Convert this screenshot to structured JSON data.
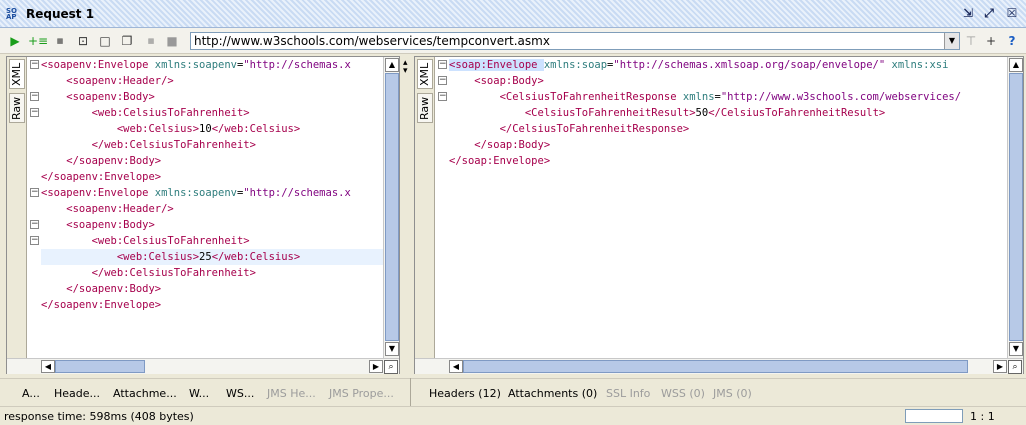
{
  "window": {
    "title": "Request 1",
    "icon": "soap-request-icon",
    "controls": [
      "detach-icon",
      "maximize-icon",
      "close-icon"
    ]
  },
  "toolbar": {
    "url": "http://www.w3schools.com/webservices/tempconvert.asmx",
    "icons": [
      "run-icon",
      "add-assertion-icon",
      "create-soap-icon",
      "restore-icon",
      "clone-icon",
      "soap-icon",
      "stop-icon"
    ],
    "right_icons": [
      "tune-icon",
      "add-icon",
      "help-icon"
    ]
  },
  "request_panel": {
    "tabs": [
      "XML",
      "Raw"
    ],
    "lines": [
      [
        {
          "c": "tag",
          "t": "<soapenv:Envelope "
        },
        {
          "c": "an",
          "t": "xmlns:soapenv"
        },
        {
          "c": "txt",
          "t": "="
        },
        {
          "c": "av",
          "t": "\"http://schemas.x"
        }
      ],
      [
        {
          "c": "tag",
          "t": "    <soapenv:Header/>"
        }
      ],
      [
        {
          "c": "tag",
          "t": "    <soapenv:Body>"
        }
      ],
      [
        {
          "c": "tag",
          "t": "        <web:CelsiusToFahrenheit>"
        }
      ],
      [
        {
          "c": "tag",
          "t": "            <web:Celsius>"
        },
        {
          "c": "txt",
          "t": "10"
        },
        {
          "c": "tag",
          "t": "</web:Celsius>"
        }
      ],
      [
        {
          "c": "tag",
          "t": "        </web:CelsiusToFahrenheit>"
        }
      ],
      [
        {
          "c": "tag",
          "t": "    </soapenv:Body>"
        }
      ],
      [
        {
          "c": "tag",
          "t": "</soapenv:Envelope>"
        }
      ],
      [
        {
          "c": "tag",
          "t": "<soapenv:Envelope "
        },
        {
          "c": "an",
          "t": "xmlns:soapenv"
        },
        {
          "c": "txt",
          "t": "="
        },
        {
          "c": "av",
          "t": "\"http://schemas.x"
        }
      ],
      [
        {
          "c": "tag",
          "t": "    <soapenv:Header/>"
        }
      ],
      [
        {
          "c": "tag",
          "t": "    <soapenv:Body>"
        }
      ],
      [
        {
          "c": "tag",
          "t": "        <web:CelsiusToFahrenheit>"
        }
      ],
      [
        {
          "c": "tag",
          "t": "            <web:Celsius>"
        },
        {
          "c": "txt",
          "t": "25"
        },
        {
          "c": "tag",
          "t": "</web:Celsius>"
        }
      ],
      [
        {
          "c": "tag",
          "t": "        </web:CelsiusToFahrenheit>"
        }
      ],
      [
        {
          "c": "tag",
          "t": "    </soapenv:Body>"
        }
      ],
      [
        {
          "c": "tag",
          "t": "</soapenv:Envelope>"
        }
      ]
    ],
    "bottom_tabs": [
      {
        "label": "A...",
        "disabled": false
      },
      {
        "label": "Heade...",
        "disabled": false
      },
      {
        "label": "Attachme...",
        "disabled": false
      },
      {
        "label": "W...",
        "disabled": false
      },
      {
        "label": "WS...",
        "disabled": false
      },
      {
        "label": "JMS He...",
        "disabled": true
      },
      {
        "label": "JMS Prope...",
        "disabled": true
      }
    ]
  },
  "response_panel": {
    "tabs": [
      "XML",
      "Raw"
    ],
    "lines": [
      [
        {
          "c": "tag hl-tag",
          "t": "<soap:Envelope "
        },
        {
          "c": "an",
          "t": "xmlns:soap"
        },
        {
          "c": "txt",
          "t": "="
        },
        {
          "c": "av",
          "t": "\"http://schemas.xmlsoap.org/soap/envelope/\""
        },
        {
          "c": "an",
          "t": " xmlns:xsi"
        }
      ],
      [
        {
          "c": "tag",
          "t": "    <soap:Body>"
        }
      ],
      [
        {
          "c": "tag",
          "t": "        <CelsiusToFahrenheitResponse "
        },
        {
          "c": "an",
          "t": "xmlns"
        },
        {
          "c": "txt",
          "t": "="
        },
        {
          "c": "av",
          "t": "\"http://www.w3schools.com/webservices/"
        }
      ],
      [
        {
          "c": "tag",
          "t": "            <CelsiusToFahrenheitResult>"
        },
        {
          "c": "txt",
          "t": "50"
        },
        {
          "c": "tag",
          "t": "</CelsiusToFahrenheitResult>"
        }
      ],
      [
        {
          "c": "tag",
          "t": "        </CelsiusToFahrenheitResponse>"
        }
      ],
      [
        {
          "c": "tag",
          "t": "    </soap:Body>"
        }
      ],
      [
        {
          "c": "tag",
          "t": "</soap:Envelope>"
        }
      ]
    ],
    "bottom_tabs": [
      {
        "label": "Headers (12)",
        "disabled": false
      },
      {
        "label": "Attachments (0)",
        "disabled": false
      },
      {
        "label": "SSL Info",
        "disabled": true
      },
      {
        "label": "WSS (0)",
        "disabled": true
      },
      {
        "label": "JMS (0)",
        "disabled": true
      }
    ]
  },
  "status": {
    "response_time": "response time: 598ms (408 bytes)",
    "cursor_position": "1 : 1"
  }
}
